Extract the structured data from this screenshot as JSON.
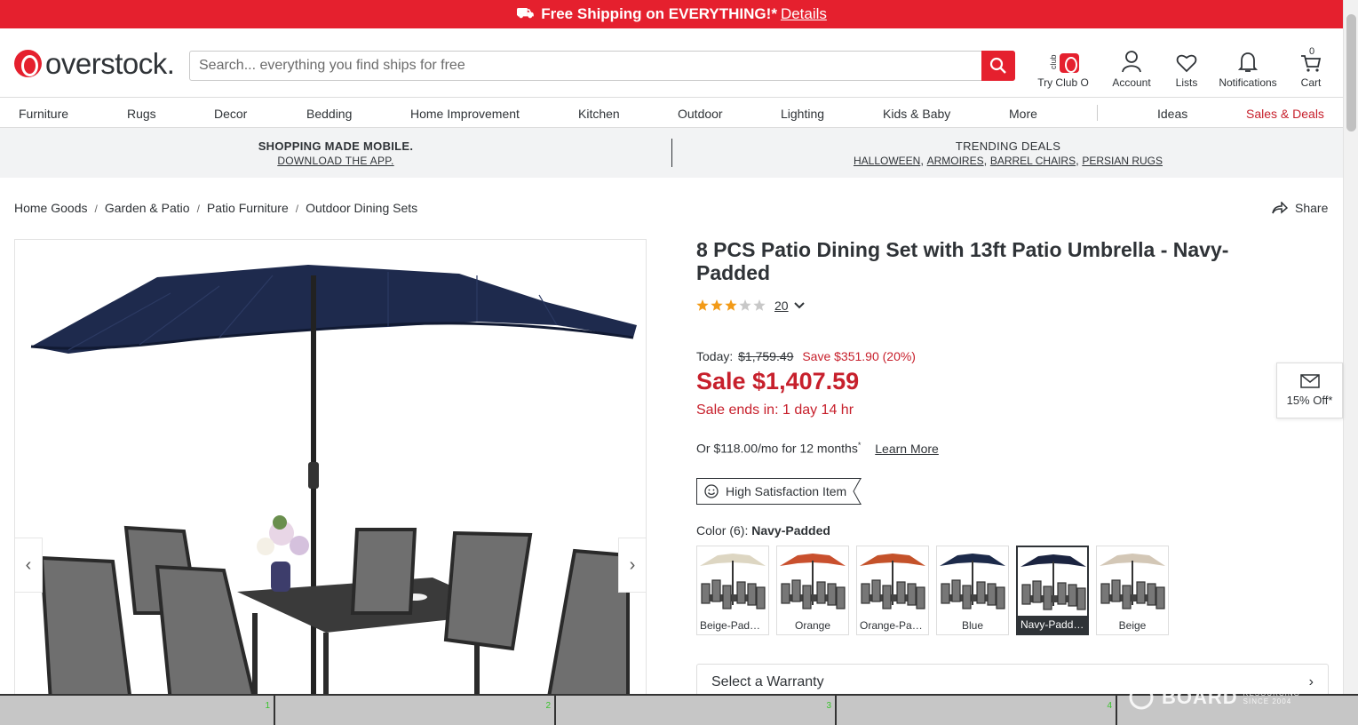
{
  "promo": {
    "text": "Free Shipping on EVERYTHING!*",
    "link": "Details"
  },
  "header": {
    "logo": "overstock.",
    "search_placeholder": "Search... everything you find ships for free",
    "icons": [
      {
        "label": "Try Club O",
        "icon": "club-o-icon"
      },
      {
        "label": "Account",
        "icon": "account-icon"
      },
      {
        "label": "Lists",
        "icon": "heart-icon"
      },
      {
        "label": "Notifications",
        "icon": "bell-icon"
      },
      {
        "label": "Cart",
        "icon": "cart-icon",
        "count": "0"
      }
    ],
    "club_small": "club"
  },
  "nav": {
    "items": [
      "Furniture",
      "Rugs",
      "Decor",
      "Bedding",
      "Home Improvement",
      "Kitchen",
      "Outdoor",
      "Lighting",
      "Kids & Baby",
      "More"
    ],
    "ideas": "Ideas",
    "sales": "Sales & Deals"
  },
  "strip": {
    "mobile_head": "SHOPPING MADE MOBILE.",
    "mobile_link": "DOWNLOAD THE APP.",
    "trending_head": "TRENDING DEALS",
    "trending_links": [
      "HALLOWEEN",
      "ARMOIRES",
      "BARREL CHAIRS",
      "PERSIAN RUGS"
    ]
  },
  "breadcrumb": [
    "Home Goods",
    "Garden & Patio",
    "Patio Furniture",
    "Outdoor Dining Sets"
  ],
  "share": "Share",
  "product": {
    "title": "8 PCS Patio Dining Set with 13ft Patio Umbrella - Navy-Padded",
    "rating": 3.5,
    "review_count": "20",
    "today_label": "Today:",
    "was_price": "$1,759.49",
    "save_text": "Save $351.90 (20%)",
    "sale_price": "Sale $1,407.59",
    "sale_ends_label": "Sale ends in:",
    "sale_ends_value": "1 day 14 hr",
    "finance_text": "Or $118.00/mo for 12 months",
    "finance_sup": "*",
    "learn_more": "Learn More",
    "badge": "High Satisfaction Item",
    "color_label": "Color (6):",
    "color_selected": "Navy-Padded",
    "swatches": [
      {
        "name": "Beige-Padded",
        "color": "#ddd6c2"
      },
      {
        "name": "Orange",
        "color": "#c9502e"
      },
      {
        "name": "Orange-Padded",
        "color": "#c4522a"
      },
      {
        "name": "Blue",
        "color": "#1c2a4a"
      },
      {
        "name": "Navy-Padded",
        "color": "#1b2440",
        "selected": true
      },
      {
        "name": "Beige",
        "color": "#d3c7b6"
      }
    ],
    "warranty": "Select a Warranty"
  },
  "discount": {
    "label": "15% Off*"
  },
  "colors": {
    "brand_red": "#e5202e",
    "sale_red": "#c7202c",
    "text": "#2f3337",
    "umbrella_navy": "#1e2a4d"
  },
  "taskbar": {
    "cells": [
      "1",
      "2",
      "3",
      "4"
    ]
  },
  "watermark": {
    "brand": "BOARD",
    "tag_1": "RESOURCING",
    "tag_2": "SINCE 2004"
  }
}
